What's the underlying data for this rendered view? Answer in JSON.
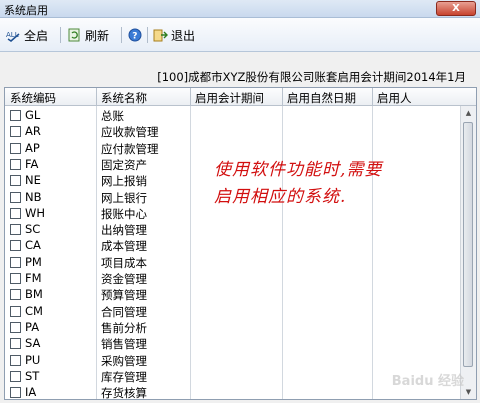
{
  "window": {
    "title": "系统启用",
    "close_label": "X"
  },
  "toolbar": {
    "enable_all": {
      "icon": "check-all-icon",
      "label": "全启"
    },
    "refresh": {
      "icon": "refresh-icon",
      "label": "刷新"
    },
    "help": {
      "icon": "help-icon"
    },
    "exit": {
      "icon": "exit-icon",
      "label": "退出"
    }
  },
  "period_text": "[100]成都市XYZ股份有限公司账套启用会计期间2014年1月",
  "table": {
    "columns": [
      "系统编码",
      "系统名称",
      "启用会计期间",
      "启用自然日期",
      "启用人"
    ],
    "rows": [
      {
        "code": "GL",
        "name": "总账"
      },
      {
        "code": "AR",
        "name": "应收款管理"
      },
      {
        "code": "AP",
        "name": "应付款管理"
      },
      {
        "code": "FA",
        "name": "固定资产"
      },
      {
        "code": "NE",
        "name": "网上报销"
      },
      {
        "code": "NB",
        "name": "网上银行"
      },
      {
        "code": "WH",
        "name": "报账中心"
      },
      {
        "code": "SC",
        "name": "出纳管理"
      },
      {
        "code": "CA",
        "name": "成本管理"
      },
      {
        "code": "PM",
        "name": "项目成本"
      },
      {
        "code": "FM",
        "name": "资金管理"
      },
      {
        "code": "BM",
        "name": "预算管理"
      },
      {
        "code": "CM",
        "name": "合同管理"
      },
      {
        "code": "PA",
        "name": "售前分析"
      },
      {
        "code": "SA",
        "name": "销售管理"
      },
      {
        "code": "PU",
        "name": "采购管理"
      },
      {
        "code": "ST",
        "name": "库存管理"
      },
      {
        "code": "IA",
        "name": "存货核算"
      }
    ]
  },
  "annotation": {
    "line1": "使用软件功能时,需要",
    "line2": "启用相应的系统."
  },
  "watermark": "Baidu 经验",
  "colors": {
    "annotation": "#d20f0f",
    "title_bar": "#c9d9ee",
    "close_button": "#c7432f"
  }
}
